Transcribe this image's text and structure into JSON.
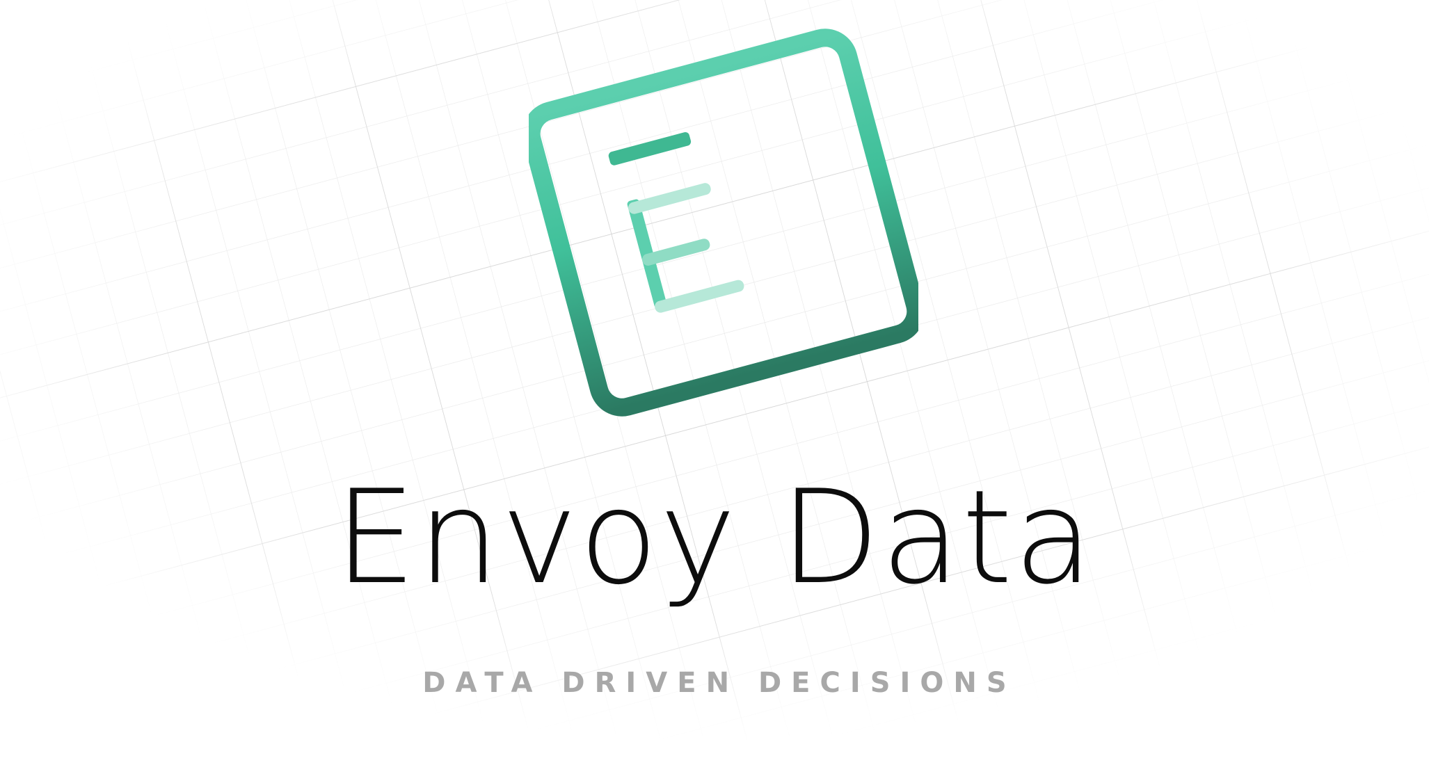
{
  "brand": {
    "name": "Envoy Data",
    "tagline": "DATA DRIVEN DECISIONS"
  },
  "logo": {
    "icon": "letter-e-tilted-frame-icon",
    "colors": {
      "gradient_top": "#5ccfae",
      "gradient_mid": "#40c09a",
      "gradient_bottom": "#2b7a62",
      "e_top_bar": "#3fb892",
      "e_stem": "#5ccfae",
      "e_middle_bar": "#8fdcc4",
      "e_light_bar": "#b6e8d8"
    }
  },
  "theme": {
    "background": "#ffffff",
    "grid_line": "#d6d6d6",
    "text": "#0d0d0d",
    "tagline_color": "#a8a8a8"
  }
}
